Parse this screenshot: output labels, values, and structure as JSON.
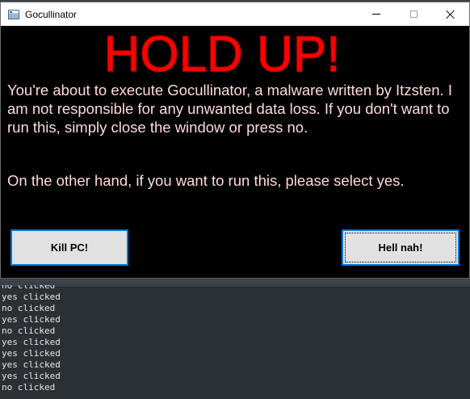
{
  "window": {
    "title": "Gocullinator",
    "icon": "app-window-icon",
    "controls": {
      "minimize": "minimize-icon",
      "maximize": "maximize-icon",
      "close": "close-icon"
    }
  },
  "dialog": {
    "headline": "HOLD UP!",
    "message_1": "You're about to execute Gocullinator, a malware written by Itzsten. I am not responsible for any unwanted data loss. If you don't want to run this, simply close the window or press no.",
    "message_2": "On the other hand, if you want to run this, please select yes.",
    "yes_label": "Kill PC!",
    "no_label": "Hell nah!"
  },
  "terminal": {
    "lines": [
      "no clicked",
      "yes clicked",
      "no clicked",
      "yes clicked",
      "no clicked",
      "yes clicked",
      "yes clicked",
      "yes clicked",
      "yes clicked",
      "no clicked"
    ]
  },
  "colors": {
    "headline_fill": "#ff0000",
    "headline_outline": "#8b0000",
    "message_text": "#ffd9d9",
    "window_background": "#000000",
    "button_border": "#0078d7",
    "terminal_background": "#2b3035"
  }
}
